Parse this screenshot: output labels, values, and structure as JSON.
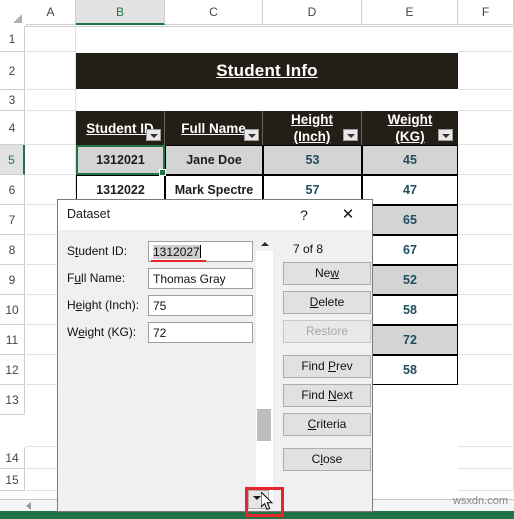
{
  "spreadsheet": {
    "columns": [
      "A",
      "B",
      "C",
      "D",
      "E",
      "F"
    ],
    "selected_column": "B",
    "rows": [
      "1",
      "2",
      "3",
      "4",
      "5",
      "6",
      "7",
      "8",
      "9",
      "10",
      "11",
      "12",
      "13",
      "14",
      "15"
    ],
    "selected_row": "5",
    "title_banner": "Student Info",
    "table_headers": [
      {
        "line1": "Student ID",
        "line2": ""
      },
      {
        "line1": "Full Name",
        "line2": ""
      },
      {
        "line1": "Height",
        "line2": "(Inch)"
      },
      {
        "line1": "Weight",
        "line2": "(KG)"
      }
    ],
    "data_rows": [
      {
        "id": "1312021",
        "name": "Jane Doe",
        "height": "53",
        "weight": "45"
      },
      {
        "id": "1312022",
        "name": "Mark Spectre",
        "height": "57",
        "weight": "47"
      },
      {
        "id": "",
        "name": "",
        "height": "",
        "weight": "65"
      },
      {
        "id": "",
        "name": "",
        "height": "",
        "weight": "67"
      },
      {
        "id": "",
        "name": "",
        "height": "",
        "weight": "52"
      },
      {
        "id": "",
        "name": "",
        "height": "",
        "weight": "58"
      },
      {
        "id": "",
        "name": "",
        "height": "",
        "weight": "72"
      },
      {
        "id": "",
        "name": "",
        "height": "",
        "weight": "58"
      }
    ],
    "watermark": "wsxdn.com"
  },
  "dialog": {
    "title": "Dataset",
    "help_icon": "question-mark-icon",
    "close_icon": "close-x-icon",
    "record_counter": "7 of 8",
    "fields": [
      {
        "label_pre": "S",
        "label_accel": "t",
        "label_post": "udent ID:",
        "value": "1312027",
        "selected": true
      },
      {
        "label_pre": "F",
        "label_accel": "u",
        "label_post": "ll Name:",
        "value": "Thomas Gray",
        "selected": false
      },
      {
        "label_pre": "H",
        "label_accel": "e",
        "label_post": "ight (Inch):",
        "value": "75",
        "selected": false
      },
      {
        "label_pre": "W",
        "label_accel": "e",
        "label_post": "ight (KG):",
        "value": "72",
        "selected": false
      }
    ],
    "buttons": [
      {
        "pre": "Ne",
        "accel": "w",
        "post": "",
        "disabled": false
      },
      {
        "pre": "",
        "accel": "D",
        "post": "elete",
        "disabled": false
      },
      {
        "pre": "Restore",
        "accel": "",
        "post": "",
        "disabled": true
      },
      {
        "pre": "Find ",
        "accel": "P",
        "post": "rev",
        "disabled": false
      },
      {
        "pre": "Find ",
        "accel": "N",
        "post": "ext",
        "disabled": false
      },
      {
        "pre": "",
        "accel": "C",
        "post": "riteria",
        "disabled": false
      },
      {
        "pre": "C",
        "accel": "l",
        "post": "ose",
        "disabled": false
      }
    ],
    "scrollbar": {
      "up_icon": "chevron-up-icon",
      "down_icon": "chevron-down-icon"
    }
  },
  "colors": {
    "excel_green": "#217346",
    "header_black": "#231f17",
    "highlight_red": "#e8252a",
    "number_blue": "#1f4e5f",
    "band_gray": "#d4d4d4"
  }
}
